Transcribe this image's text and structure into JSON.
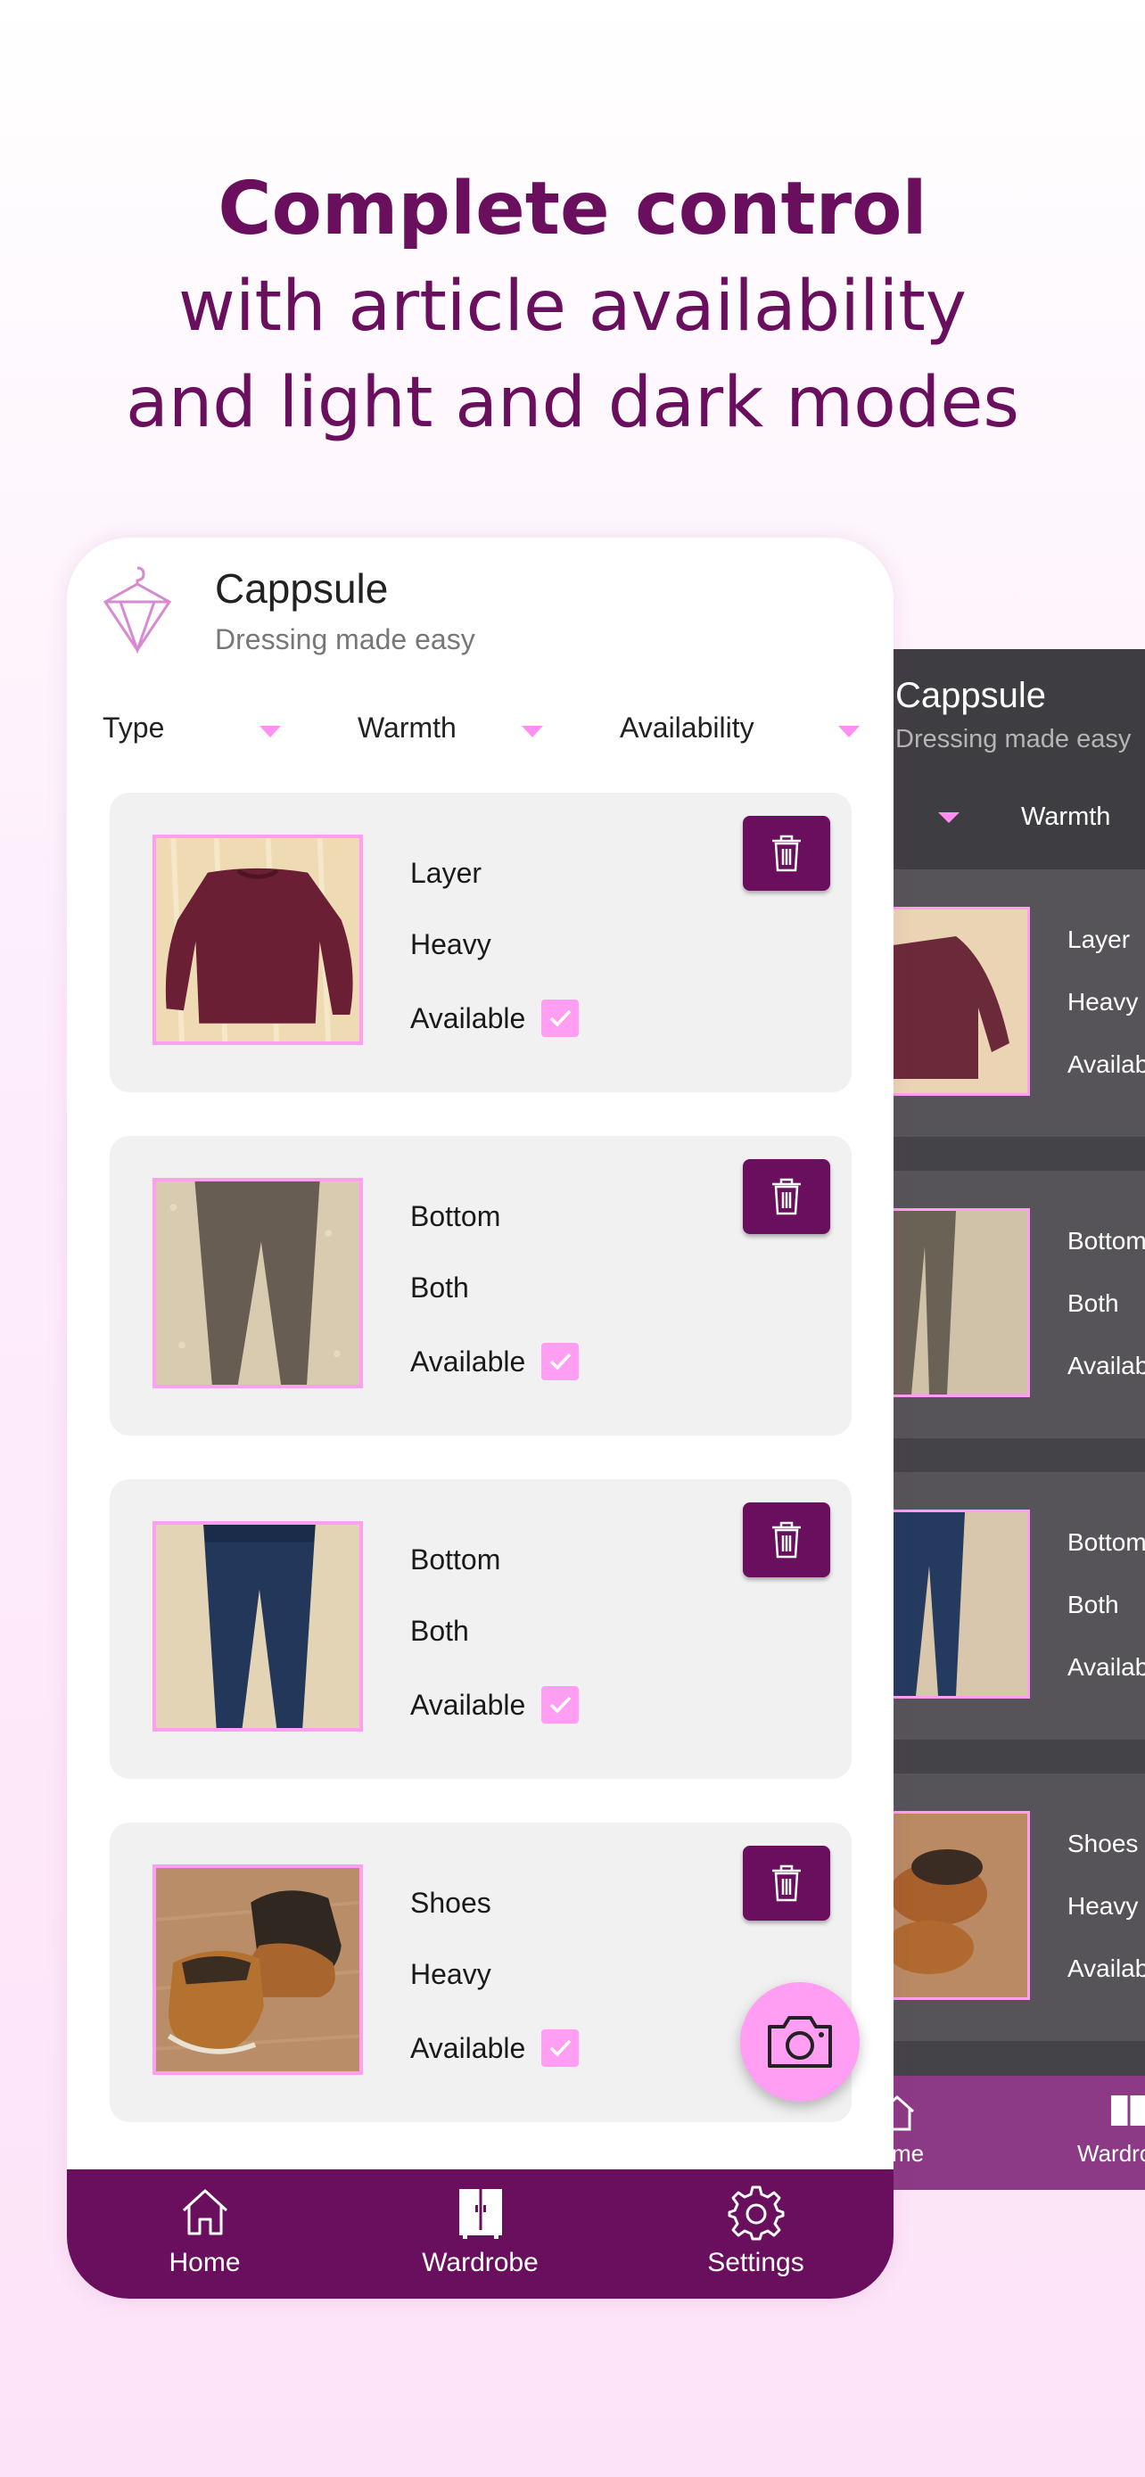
{
  "headline": {
    "line1": "Complete control",
    "line2": "with article availability",
    "line3": "and light and dark modes"
  },
  "app": {
    "title": "Cappsule",
    "subtitle": "Dressing made easy",
    "logo_icon": "hanger-diamond-icon"
  },
  "filters": [
    {
      "label": "Type",
      "icon": "dropdown-arrow-icon"
    },
    {
      "label": "Warmth",
      "icon": "dropdown-arrow-icon"
    },
    {
      "label": "Availability",
      "icon": "dropdown-arrow-icon"
    }
  ],
  "items": [
    {
      "type": "Layer",
      "warmth": "Heavy",
      "availability": "Available",
      "checked": true,
      "photo": "maroon-sweater"
    },
    {
      "type": "Bottom",
      "warmth": "Both",
      "availability": "Available",
      "checked": true,
      "photo": "grey-trousers"
    },
    {
      "type": "Bottom",
      "warmth": "Both",
      "availability": "Available",
      "checked": true,
      "photo": "blue-jeans"
    },
    {
      "type": "Shoes",
      "warmth": "Heavy",
      "availability": "Available",
      "checked": true,
      "photo": "tan-boots"
    }
  ],
  "fab": {
    "icon": "camera-icon"
  },
  "nav": [
    {
      "label": "Home",
      "icon": "home-icon"
    },
    {
      "label": "Wardrobe",
      "icon": "wardrobe-icon"
    },
    {
      "label": "Settings",
      "icon": "gear-icon"
    }
  ],
  "dark_preview": {
    "title": "Cappsule",
    "subtitle": "Dressing made easy",
    "filter_label": "Warmth",
    "items": [
      {
        "type": "Layer",
        "warmth": "Heavy",
        "availability": "Availab"
      },
      {
        "type": "Bottom",
        "warmth": "Both",
        "availability": "Availab"
      },
      {
        "type": "Bottom",
        "warmth": "Both",
        "availability": "Availab"
      },
      {
        "type": "Shoes",
        "warmth": "Heavy",
        "availability": "Availab"
      }
    ],
    "nav": [
      {
        "label": "me"
      },
      {
        "label": "Wardro"
      }
    ]
  },
  "colors": {
    "brand": "#6a0e5e",
    "accent_pink": "#ff9ef3",
    "card_bg": "#f1f1f1",
    "dark_bg": "#444348",
    "dark_nav": "#8c3a85"
  }
}
